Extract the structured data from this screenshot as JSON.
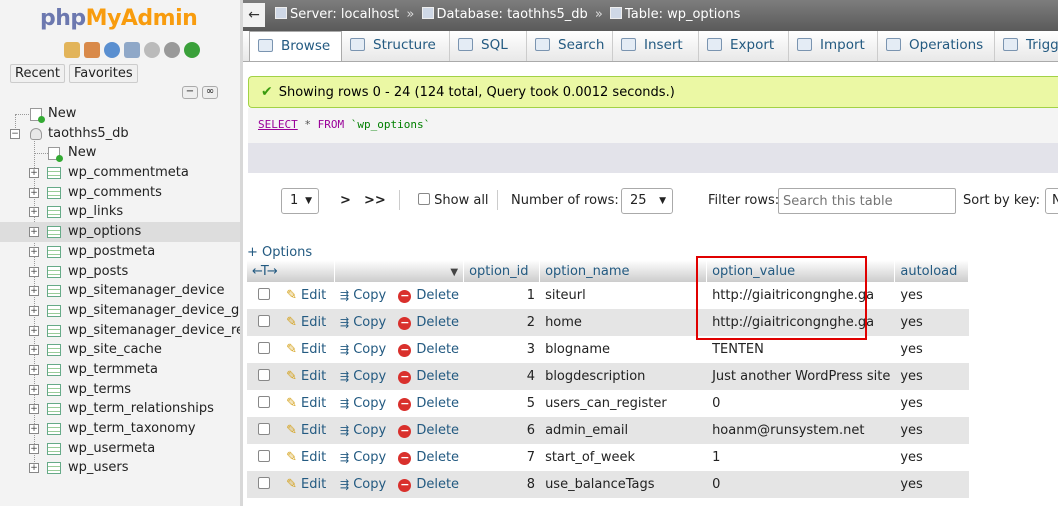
{
  "logo": {
    "part1": "php",
    "part2": "MyAdmin"
  },
  "nav": {
    "recent_label": "Recent",
    "favorites_label": "Favorites",
    "new_label": "New",
    "database": "taothhs5_db",
    "db_new_label": "New",
    "tables": [
      "wp_commentmeta",
      "wp_comments",
      "wp_links",
      "wp_options",
      "wp_postmeta",
      "wp_posts",
      "wp_sitemanager_device",
      "wp_sitemanager_device_grou",
      "wp_sitemanager_device_relat",
      "wp_site_cache",
      "wp_termmeta",
      "wp_terms",
      "wp_term_relationships",
      "wp_term_taxonomy",
      "wp_usermeta",
      "wp_users"
    ],
    "selected_table": "wp_options"
  },
  "breadcrumb": {
    "server": "Server: localhost",
    "database": "Database: taothhs5_db",
    "table": "Table: wp_options",
    "separator": "»"
  },
  "tabs": [
    "Browse",
    "Structure",
    "SQL",
    "Search",
    "Insert",
    "Export",
    "Import",
    "Operations",
    "Trigg"
  ],
  "active_tab": "Browse",
  "message": "Showing rows 0 - 24 (124 total, Query took 0.0012 seconds.)",
  "sql": {
    "select": "SELECT",
    "star": "*",
    "from": "FROM",
    "table": "`wp_options`"
  },
  "pager": {
    "page": "1",
    "next": ">",
    "last": ">>",
    "show_all": "Show all",
    "rows_label": "Number of rows:",
    "rows_value": "25",
    "filter_label": "Filter rows:",
    "filter_placeholder": "Search this table",
    "sort_label": "Sort by key:",
    "sort_value": "N"
  },
  "options_link": "+ Options",
  "columns": [
    "option_id",
    "option_name",
    "option_value",
    "autoload"
  ],
  "actions": {
    "edit": "Edit",
    "copy": "Copy",
    "delete": "Delete"
  },
  "rows": [
    {
      "option_id": "1",
      "option_name": "siteurl",
      "option_value": "http://giaitricongnghe.ga",
      "autoload": "yes"
    },
    {
      "option_id": "2",
      "option_name": "home",
      "option_value": "http://giaitricongnghe.ga",
      "autoload": "yes"
    },
    {
      "option_id": "3",
      "option_name": "blogname",
      "option_value": "TENTEN",
      "autoload": "yes"
    },
    {
      "option_id": "4",
      "option_name": "blogdescription",
      "option_value": "Just another WordPress site",
      "autoload": "yes"
    },
    {
      "option_id": "5",
      "option_name": "users_can_register",
      "option_value": "0",
      "autoload": "yes"
    },
    {
      "option_id": "6",
      "option_name": "admin_email",
      "option_value": "hoanm@runsystem.net",
      "autoload": "yes"
    },
    {
      "option_id": "7",
      "option_name": "start_of_week",
      "option_value": "1",
      "autoload": "yes"
    },
    {
      "option_id": "8",
      "option_name": "use_balanceTags",
      "option_value": "0",
      "autoload": "yes"
    }
  ],
  "colors": {
    "highlight": "#e00000",
    "link": "#235a81",
    "success_bg": "#ebf8a4"
  }
}
